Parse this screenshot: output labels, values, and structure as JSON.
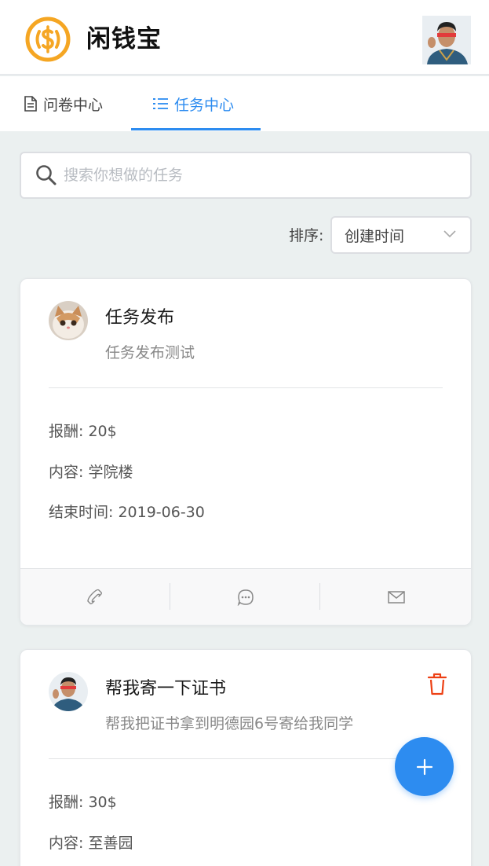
{
  "header": {
    "app_title": "闲钱宝",
    "logo_icon": "dollar-coin-icon",
    "brand_color": "#f5a623"
  },
  "tabs": [
    {
      "label": "问卷中心",
      "icon": "document-icon",
      "active": false
    },
    {
      "label": "任务中心",
      "icon": "list-icon",
      "active": true
    }
  ],
  "search": {
    "placeholder": "搜索你想做的任务",
    "value": ""
  },
  "sort": {
    "label": "排序:",
    "selected": "创建时间"
  },
  "tasks": [
    {
      "title": "任务发布",
      "subtitle": "任务发布测试",
      "reward": "报酬: 20$",
      "content": "内容: 学院楼",
      "end_time": "结束时间: 2019-06-30",
      "actions": [
        "phone-icon",
        "chat-icon",
        "mail-icon"
      ]
    },
    {
      "title": "帮我寄一下证书",
      "subtitle": "帮我把证书拿到明德园6号寄给我同学",
      "reward": "报酬: 30$",
      "content": "内容: 至善园",
      "deletable": true
    }
  ],
  "colors": {
    "accent": "#2d8cf0",
    "delete": "#ed4014",
    "background": "#ebf0f0"
  }
}
